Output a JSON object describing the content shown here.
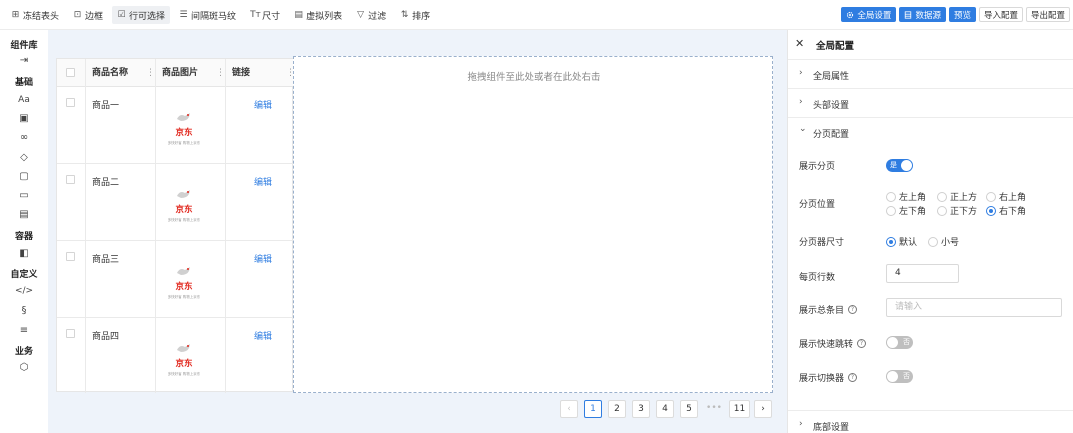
{
  "toolbar": {
    "items": [
      {
        "label": "冻结表头",
        "icon": "freeze-header-icon",
        "glyph": "⊞"
      },
      {
        "label": "边框",
        "icon": "border-icon",
        "glyph": "⊡"
      },
      {
        "label": "行可选择",
        "icon": "checkbox-icon",
        "glyph": "☑"
      },
      {
        "label": "间隔斑马纹",
        "icon": "stripe-icon",
        "glyph": "☰"
      },
      {
        "label": "尺寸",
        "icon": "text-size-icon",
        "glyph": "Tт"
      },
      {
        "label": "虚拟列表",
        "icon": "virtual-list-icon",
        "glyph": "▤"
      },
      {
        "label": "过滤",
        "icon": "filter-icon",
        "glyph": "▽"
      },
      {
        "label": "排序",
        "icon": "sort-icon",
        "glyph": "⇅"
      }
    ],
    "global_settings": "全局设置",
    "datasource": "数据源",
    "preview": "预览",
    "import_config": "导入配置",
    "export_config": "导出配置"
  },
  "sidebar": {
    "title": "组件库",
    "group_basic": "基础",
    "group_container": "容器",
    "group_custom": "自定义",
    "group_business": "业务"
  },
  "table": {
    "columns": [
      "商品名称",
      "商品图片",
      "链接"
    ],
    "rows": [
      {
        "name": "商品一",
        "link": "编辑"
      },
      {
        "name": "商品二",
        "link": "编辑"
      },
      {
        "name": "商品三",
        "link": "编辑"
      },
      {
        "name": "商品四",
        "link": "编辑"
      }
    ],
    "thumb_brand": "京东",
    "thumb_slogan": "多快好省 购物上京东"
  },
  "dropzone": {
    "text": "拖拽组件至此处或者在此处右击"
  },
  "pagination": {
    "prev": "‹",
    "next": "›",
    "pages": [
      "1",
      "2",
      "3",
      "4",
      "5"
    ],
    "ellipsis": "•••",
    "last": "11",
    "current": "1"
  },
  "panel": {
    "close": "✕",
    "title": "全局配置",
    "sections": {
      "global_props": "全局属性",
      "header_settings": "头部设置",
      "pagination_config": "分页配置",
      "footer_settings": "底部设置"
    },
    "show_pagination": {
      "label": "展示分页",
      "toggle_text": "是",
      "on": true
    },
    "position": {
      "label": "分页位置",
      "options": [
        "左上角",
        "正上方",
        "右上角",
        "左下角",
        "正下方",
        "右下角"
      ],
      "selected": "右下角"
    },
    "size": {
      "label": "分页器尺寸",
      "options": [
        "默认",
        "小号"
      ],
      "selected": "默认"
    },
    "rows_per_page": {
      "label": "每页行数",
      "value": "4"
    },
    "show_total": {
      "label": "展示总条目",
      "placeholder": "请输入"
    },
    "quick_jump": {
      "label": "展示快速跳转",
      "toggle_text": "否",
      "on": false
    },
    "size_changer": {
      "label": "展示切换器",
      "toggle_text": "否",
      "on": false
    }
  },
  "colors": {
    "accent": "#2f7de1",
    "canvas_bg": "#eef3fa",
    "brand_red": "#e1251b"
  }
}
